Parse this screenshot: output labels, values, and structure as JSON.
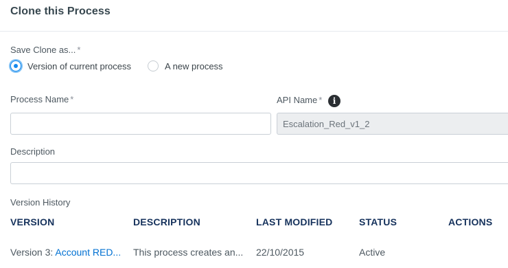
{
  "header": {
    "title": "Clone this Process"
  },
  "save_clone": {
    "label": "Save Clone as...",
    "required_mark": "*",
    "options": [
      {
        "label": "Version of current process",
        "checked": true
      },
      {
        "label": "A new process",
        "checked": false
      }
    ]
  },
  "process_name": {
    "label": "Process Name",
    "required_mark": "*",
    "value": ""
  },
  "api_name": {
    "label": "API Name",
    "required_mark": "*",
    "value": "Escalation_Red_v1_2",
    "info_icon": "info-icon"
  },
  "description": {
    "label": "Description",
    "value": ""
  },
  "version_history": {
    "label": "Version History",
    "columns": [
      "VERSION",
      "DESCRIPTION",
      "LAST MODIFIED",
      "STATUS",
      "ACTIONS"
    ],
    "rows": [
      {
        "version_prefix": "Version 3: ",
        "version_link": "Account RED...",
        "description": "This process creates an...",
        "last_modified": "22/10/2015",
        "status": "Active"
      }
    ]
  },
  "colors": {
    "accent": "#1589ee",
    "link": "#0070d2",
    "heading": "#16325c"
  }
}
